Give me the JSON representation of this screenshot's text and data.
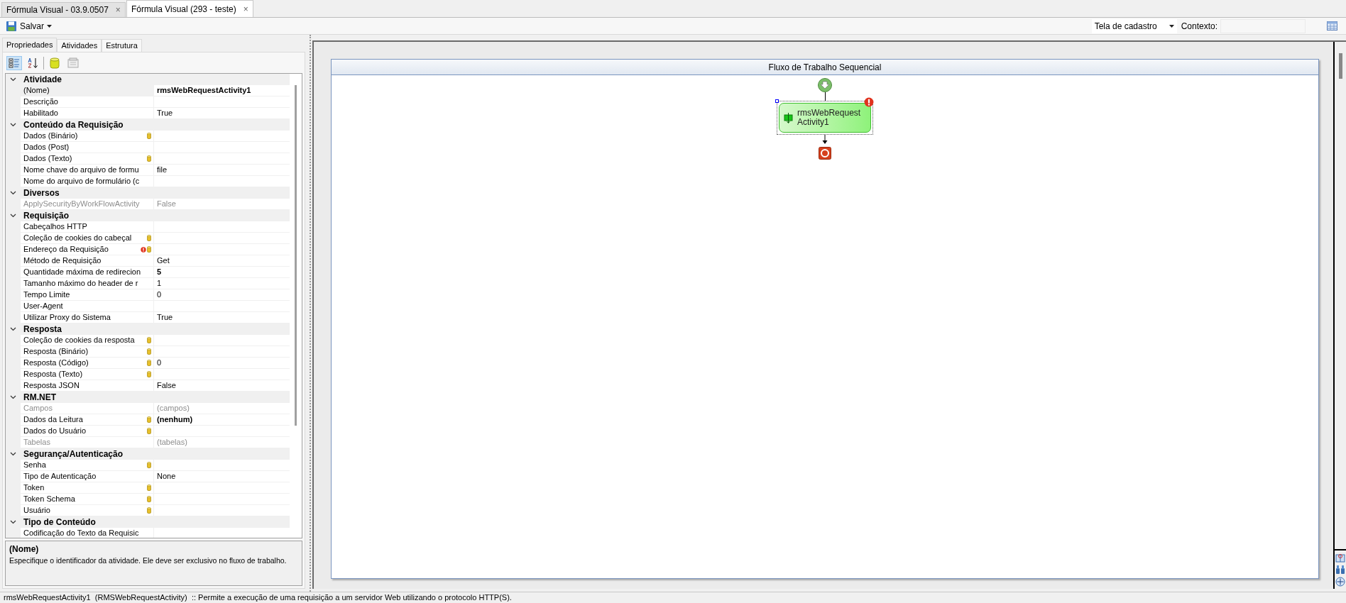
{
  "document_tabs": [
    {
      "label": "Fórmula Visual - 03.9.0507",
      "close": "×",
      "selected": false
    },
    {
      "label": "Fórmula Visual (293 - teste)",
      "close": "×",
      "selected": true
    }
  ],
  "toolbar": {
    "save": "Salvar",
    "screen_select": {
      "value": "Tela de cadastro"
    },
    "context_label": "Contexto:"
  },
  "panel_tabs": [
    {
      "label": "Propriedades",
      "selected": true
    },
    {
      "label": "Atividades",
      "selected": false
    },
    {
      "label": "Estrutura",
      "selected": false
    }
  ],
  "property_toolbar": [
    {
      "kind": "categorized",
      "selected": true
    },
    {
      "kind": "alphabetical",
      "selected": false
    },
    {
      "kind": "database",
      "selected": false
    },
    {
      "kind": "pages",
      "selected": false
    }
  ],
  "categories": [
    {
      "name": "Atividade",
      "expanded": true,
      "properties": [
        {
          "label": "(Nome)",
          "value": "rmsWebRequestActivity1",
          "modified": true,
          "selected": true,
          "disabled": false,
          "bound": false,
          "error": false
        },
        {
          "label": "Descrição",
          "selected": false,
          "disabled": false,
          "bound": false,
          "error": false
        },
        {
          "label": "Habilitado",
          "value": "True",
          "selected": false,
          "modified": false,
          "disabled": false,
          "bound": false,
          "error": false
        }
      ]
    },
    {
      "name": "Conteúdo da Requisição",
      "expanded": true,
      "properties": [
        {
          "label": "Dados (Binário)",
          "selected": false,
          "disabled": false,
          "bound": true,
          "error": false
        },
        {
          "label": "Dados (Post)",
          "selected": false,
          "disabled": false,
          "bound": false,
          "error": false
        },
        {
          "label": "Dados (Texto)",
          "selected": false,
          "disabled": false,
          "bound": true,
          "error": false
        },
        {
          "label": "Nome chave do arquivo de formu",
          "value": "file",
          "selected": false,
          "modified": false,
          "disabled": false,
          "bound": false,
          "error": false
        },
        {
          "label": "Nome do arquivo de formulário (c",
          "selected": false,
          "disabled": false,
          "bound": false,
          "error": false
        }
      ]
    },
    {
      "name": "Diversos",
      "expanded": true,
      "properties": [
        {
          "label": "ApplySecurityByWorkFlowActivity",
          "value": "False",
          "selected": false,
          "modified": false,
          "disabled": true,
          "bound": false,
          "error": false
        }
      ]
    },
    {
      "name": "Requisição",
      "expanded": true,
      "properties": [
        {
          "label": "Cabeçalhos HTTP",
          "selected": false,
          "disabled": false,
          "bound": false,
          "error": false
        },
        {
          "label": "Coleção de cookies do cabeçal",
          "selected": false,
          "disabled": false,
          "bound": true,
          "error": false
        },
        {
          "label": "Endereço da Requisição",
          "selected": false,
          "disabled": false,
          "bound": true,
          "error": true
        },
        {
          "label": "Método de Requisição",
          "value": "Get",
          "selected": false,
          "modified": false,
          "disabled": false,
          "bound": false,
          "error": false
        },
        {
          "label": "Quantidade máxima de redirecion",
          "value": "5",
          "selected": false,
          "modified": true,
          "disabled": false,
          "bound": false,
          "error": false
        },
        {
          "label": "Tamanho máximo do header de r",
          "value": "1",
          "selected": false,
          "modified": false,
          "disabled": false,
          "bound": false,
          "error": false
        },
        {
          "label": "Tempo Limite",
          "value": "0",
          "selected": false,
          "modified": false,
          "disabled": false,
          "bound": false,
          "error": false
        },
        {
          "label": "User-Agent",
          "selected": false,
          "disabled": false,
          "bound": false,
          "error": false
        },
        {
          "label": "Utilizar Proxy do Sistema",
          "value": "True",
          "selected": false,
          "modified": false,
          "disabled": false,
          "bound": false,
          "error": false
        }
      ]
    },
    {
      "name": "Resposta",
      "expanded": true,
      "properties": [
        {
          "label": "Coleção de cookies da resposta",
          "selected": false,
          "disabled": false,
          "bound": true,
          "error": false
        },
        {
          "label": "Resposta (Binário)",
          "selected": false,
          "disabled": false,
          "bound": true,
          "error": false
        },
        {
          "label": "Resposta (Código)",
          "value": "0",
          "selected": false,
          "modified": false,
          "disabled": false,
          "bound": true,
          "error": false
        },
        {
          "label": "Resposta (Texto)",
          "selected": false,
          "disabled": false,
          "bound": true,
          "error": false
        },
        {
          "label": "Resposta JSON",
          "value": "False",
          "selected": false,
          "modified": false,
          "disabled": false,
          "bound": false,
          "error": false
        }
      ]
    },
    {
      "name": "RM.NET",
      "expanded": true,
      "properties": [
        {
          "label": "Campos",
          "value": "(campos)",
          "selected": false,
          "modified": false,
          "disabled": true,
          "bound": false,
          "error": false
        },
        {
          "label": "Dados da Leitura",
          "value": "(nenhum)",
          "selected": false,
          "modified": true,
          "disabled": false,
          "bound": true,
          "error": false
        },
        {
          "label": "Dados do Usuário",
          "selected": false,
          "disabled": false,
          "bound": true,
          "error": false
        },
        {
          "label": "Tabelas",
          "value": "(tabelas)",
          "selected": false,
          "modified": false,
          "disabled": true,
          "bound": false,
          "error": false
        }
      ]
    },
    {
      "name": "Segurança/Autenticação",
      "expanded": true,
      "properties": [
        {
          "label": "Senha",
          "selected": false,
          "disabled": false,
          "bound": true,
          "error": false
        },
        {
          "label": "Tipo de Autenticação",
          "value": "None",
          "selected": false,
          "modified": false,
          "disabled": false,
          "bound": false,
          "error": false
        },
        {
          "label": "Token",
          "selected": false,
          "disabled": false,
          "bound": true,
          "error": false
        },
        {
          "label": "Token Schema",
          "selected": false,
          "disabled": false,
          "bound": true,
          "error": false
        },
        {
          "label": "Usuário",
          "selected": false,
          "disabled": false,
          "bound": true,
          "error": false
        }
      ]
    },
    {
      "name": "Tipo de Conteúdo",
      "expanded": true,
      "properties": [
        {
          "label": "Codificação do Texto da Requisic",
          "selected": false,
          "disabled": false,
          "bound": false,
          "error": false
        }
      ]
    }
  ],
  "description": {
    "title": "(Nome)",
    "text": "Especifique o identificador da atividade. Ele deve ser exclusivo no fluxo de trabalho."
  },
  "designer": {
    "title": "Fluxo de Trabalho Sequencial",
    "activities": [
      {
        "name": "rmsWebRequestActivity1",
        "selected": true,
        "error": true
      }
    ]
  },
  "status_bar": "rmsWebRequestActivity1  (RMSWebRequestActivity)  :: Permite a execução de uma requisição a um servidor Web utilizando o protocolo HTTP(S)."
}
